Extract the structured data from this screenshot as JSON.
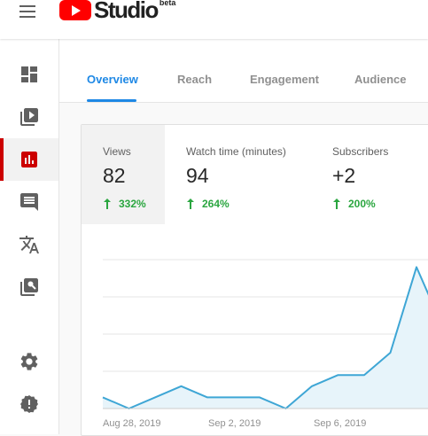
{
  "header": {
    "logo_text": "Studio",
    "logo_badge": "beta"
  },
  "sidebar": {
    "items": [
      {
        "name": "dashboard",
        "icon": "dashboard-icon"
      },
      {
        "name": "videos",
        "icon": "video-library-icon"
      },
      {
        "name": "analytics",
        "icon": "analytics-icon",
        "active": true
      },
      {
        "name": "comments",
        "icon": "comment-icon"
      },
      {
        "name": "subtitles",
        "icon": "translate-icon"
      },
      {
        "name": "copyright",
        "icon": "copyright-search-icon"
      },
      {
        "name": "settings",
        "icon": "gear-icon"
      },
      {
        "name": "feedback",
        "icon": "feedback-icon"
      }
    ]
  },
  "tabs": [
    {
      "label": "Overview",
      "active": true
    },
    {
      "label": "Reach"
    },
    {
      "label": "Engagement"
    },
    {
      "label": "Audience"
    }
  ],
  "metrics": [
    {
      "label": "Views",
      "value": "82",
      "delta": "332%",
      "active": true
    },
    {
      "label": "Watch time (minutes)",
      "value": "94",
      "delta": "264%"
    },
    {
      "label": "Subscribers",
      "value": "+2",
      "delta": "200%"
    }
  ],
  "colors": {
    "accent": "#1e88e5",
    "positive": "#2ba640",
    "brand_red": "#ff0000",
    "line": "#3ea6d5",
    "area": "#e7f4fa"
  },
  "chart_data": {
    "type": "area",
    "x_labels": [
      "Aug 28, 2019",
      "Sep 2, 2019",
      "Sep 6, 2019"
    ],
    "values": [
      3,
      0,
      3,
      6,
      3,
      3,
      3,
      0,
      6,
      9,
      9,
      15,
      38,
      22
    ],
    "ylim": [
      0,
      40
    ],
    "grid": true
  }
}
